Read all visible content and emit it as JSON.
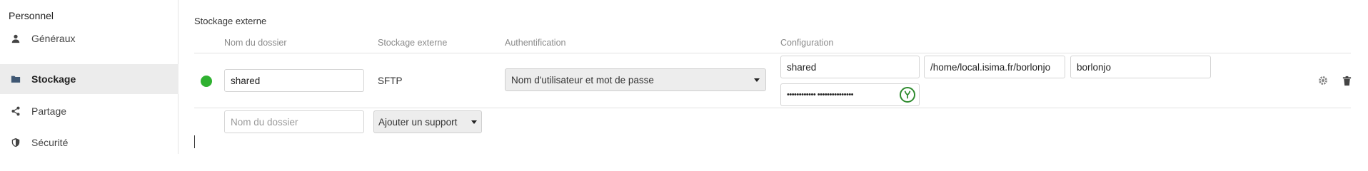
{
  "sidebar": {
    "section_title": "Personnel",
    "items": [
      {
        "label": "Généraux",
        "icon": "person-icon",
        "active": false
      },
      {
        "label": "Stockage",
        "icon": "folder-icon",
        "active": true
      },
      {
        "label": "Partage",
        "icon": "share-icon",
        "active": false
      },
      {
        "label": "Sécurité",
        "icon": "shield-icon",
        "active": false
      }
    ]
  },
  "main": {
    "title": "Stockage externe",
    "columns": {
      "folder_name": "Nom du dossier",
      "external_storage": "Stockage externe",
      "authentication": "Authentification",
      "configuration": "Configuration"
    },
    "mount": {
      "status": "ok",
      "status_color": "#2fb130",
      "folder_name": "shared",
      "backend": "SFTP",
      "auth_method": "Nom d'utilisateur et mot de passe",
      "config": {
        "host": "shared",
        "root": "/home/local.isima.fr/borlonjo",
        "user": "borlonjo",
        "password_masked": "•••••••••••• •••••••••••••••"
      },
      "password_icon": "password-manager-icon",
      "settings_icon": "gear-icon",
      "delete_icon": "trash-icon"
    },
    "new_mount": {
      "folder_placeholder": "Nom du dossier",
      "add_label": "Ajouter un support"
    }
  }
}
